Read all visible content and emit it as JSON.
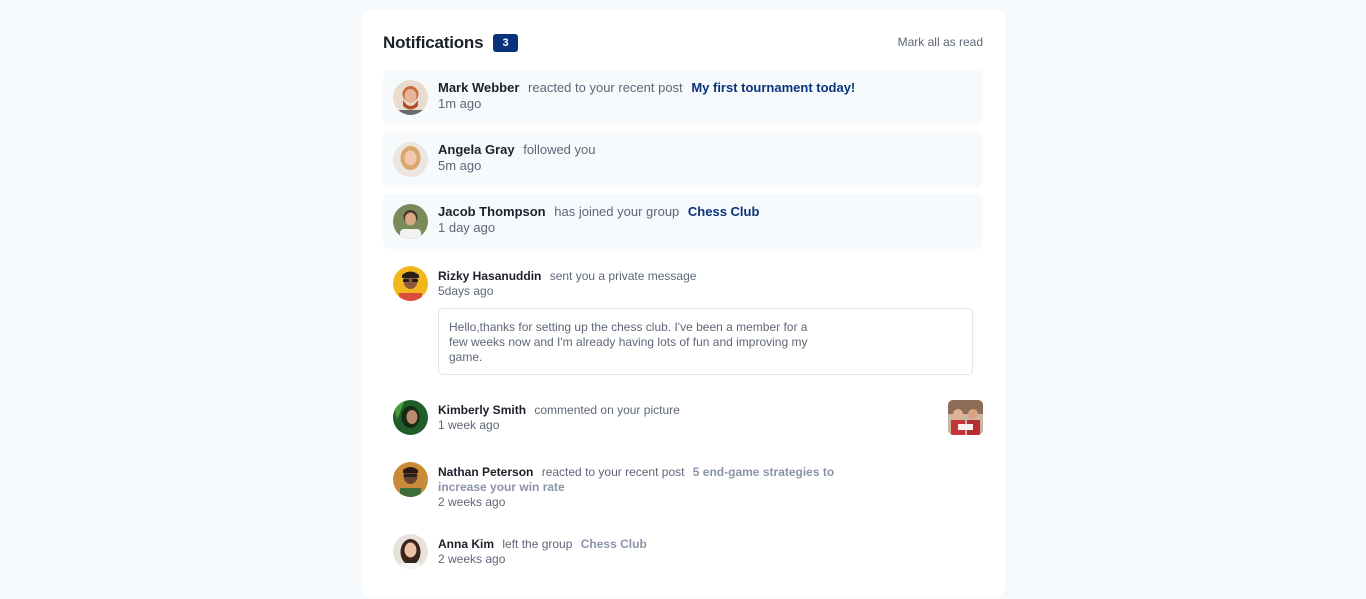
{
  "header": {
    "title": "Notifications",
    "count": "3",
    "mark_all": "Mark all as read"
  },
  "notifications": [
    {
      "name": "Mark Webber",
      "action": "reacted to your recent post",
      "target": "My first tournament today!",
      "time": "1m ago",
      "unread": true
    },
    {
      "name": "Angela Gray",
      "action": "followed you",
      "time": "5m ago",
      "unread": true
    },
    {
      "name": "Jacob Thompson",
      "action": "has joined your group",
      "target": "Chess Club",
      "time": "1 day ago",
      "unread": true
    },
    {
      "name": "Rizky Hasanuddin",
      "action": "sent you a private message",
      "time": "5days ago",
      "message": "Hello,thanks for setting up the chess club. I've been a member for a few weeks now and I'm already having lots of fun and improving my game.",
      "unread": false
    },
    {
      "name": "Kimberly Smith",
      "action": "commented on your picture",
      "time": "1 week ago",
      "unread": false
    },
    {
      "name": "Nathan Peterson",
      "action": "reacted to your recent post",
      "target_line1": "5 end-game strategies to",
      "target_line2": "increase your win rate",
      "time": "2 weeks ago",
      "unread": false
    },
    {
      "name": "Anna Kim",
      "action": "left the group",
      "target": "Chess Club",
      "time": "2 weeks ago",
      "unread": false
    }
  ],
  "colors": {
    "background": "#f7fafd",
    "navy": "#0a327b",
    "heading": "#1c202b",
    "text": "#5e6778",
    "muted_link": "#8a94a8"
  }
}
